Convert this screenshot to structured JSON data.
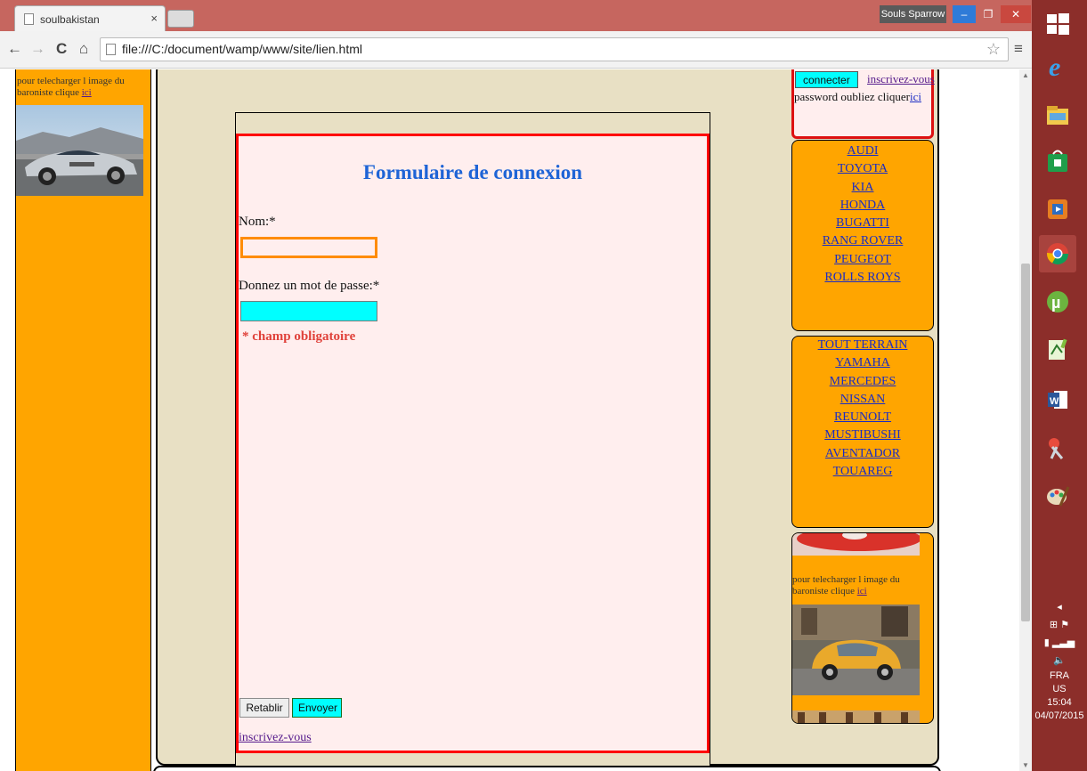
{
  "browser": {
    "tab_title": "soulbakistan",
    "tab_close": "×",
    "url": "file:///C:/document/wamp/www/site/lien.html",
    "user_name": "Souls Sparrow",
    "win_min": "–",
    "win_max": "❐",
    "win_close": "✕",
    "back": "←",
    "forward": "→",
    "reload": "C",
    "home": "⌂",
    "star": "☆",
    "menu": "≡"
  },
  "left_sidebar": {
    "download_text": "pour telecharger l image du baroniste clique",
    "download_link": "ici"
  },
  "form": {
    "title": "Formulaire de connexion",
    "name_label": "Nom:*",
    "name_value": "",
    "password_label": "Donnez un mot de passe:*",
    "password_value": "",
    "required_note": "* champ obligatoire",
    "reset_label": "Retablir",
    "submit_label": "Envoyer",
    "signup_link": "inscrivez-vous"
  },
  "login_box": {
    "connect_label": "connecter",
    "signup_link": "inscrivez-vous",
    "forgot_text": "password oubliez cliquer",
    "forgot_link": "ici"
  },
  "brands_1": [
    "AUDI",
    "TOYOTA",
    "KIA",
    "HONDA",
    "BUGATTI",
    "RANG ROVER",
    "PEUGEOT",
    "ROLLS ROYS"
  ],
  "brands_2": [
    "TOUT TERRAIN",
    "YAMAHA",
    "MERCEDES",
    "NISSAN",
    "REUNOLT",
    "MUSTIBUSHI",
    "AVENTADOR",
    "TOUAREG"
  ],
  "promo": {
    "download_text": "pour telecharger l image du baroniste clique",
    "download_link": "ici"
  },
  "taskbar": {
    "lang": "FRA",
    "region": "US",
    "time": "15:04",
    "date": "04/07/2015"
  },
  "colors": {
    "tab_bar": "#c6665f",
    "sidebar_orange": "#ffa500",
    "form_border": "#ff0000",
    "title_blue": "#1e64d6",
    "cyan": "#00ffff",
    "taskbar": "#8c2e2a"
  }
}
